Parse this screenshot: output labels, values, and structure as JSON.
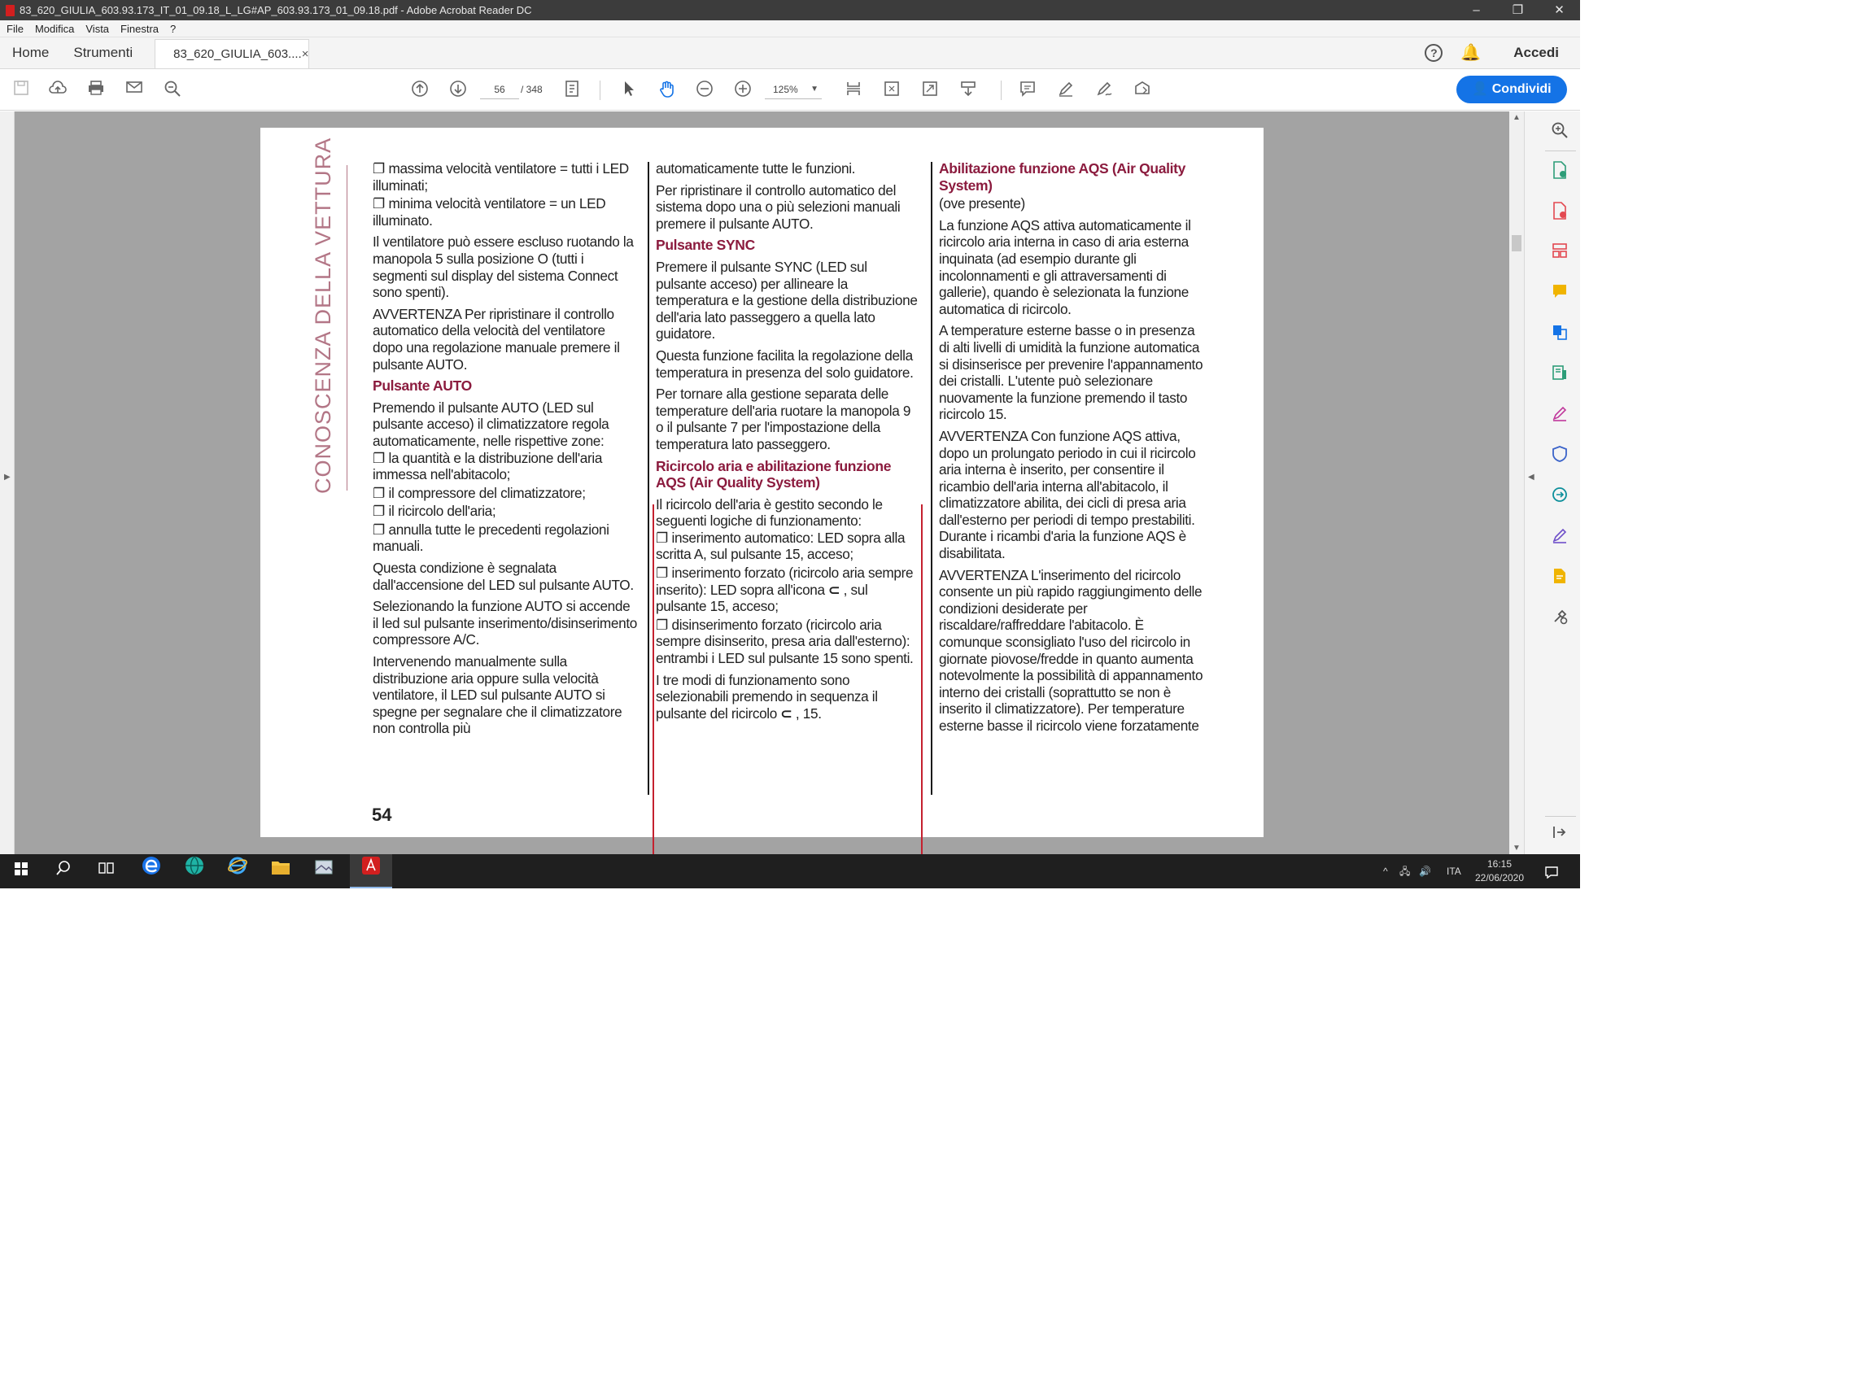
{
  "window": {
    "title": "83_620_GIULIA_603.93.173_IT_01_09.18_L_LG#AP_603.93.173_01_09.18.pdf - Adobe Acrobat Reader DC",
    "minimize": "–",
    "restore": "❐",
    "close": "✕"
  },
  "menu": [
    "File",
    "Modifica",
    "Vista",
    "Finestra",
    "?"
  ],
  "tabs": {
    "home": "Home",
    "tools": "Strumenti",
    "document": "83_620_GIULIA_603....",
    "close": "×",
    "help": "?",
    "signin": "Accedi"
  },
  "toolbar": {
    "page_current": "56",
    "page_total": "/ 348",
    "zoom": "125%",
    "share_label": "Condividi",
    "accent": "#1473e6"
  },
  "document": {
    "side_banner": "CONOSCENZA DELLA VETTURA",
    "page_number": "54",
    "heading_color": "#8b1b3e",
    "col1": {
      "l1": "❐ massima velocità ventilatore = tutti i LED illuminati;",
      "l2": "❐ minima velocità ventilatore = un LED illuminato.",
      "p1": "Il ventilatore può essere escluso ruotando la manopola 5 sulla posizione O (tutti i segmenti sul display del sistema Connect sono spenti).",
      "p2": "AVVERTENZA Per ripristinare il controllo automatico della velocità del ventilatore dopo una regolazione manuale premere il pulsante AUTO.",
      "h1": "Pulsante AUTO",
      "p3": "Premendo il pulsante AUTO (LED sul pulsante acceso) il climatizzatore regola automaticamente, nelle rispettive zone:",
      "l3": "❐ la quantità e la distribuzione dell'aria immessa nell'abitacolo;",
      "l4": "❐ il compressore del climatizzatore;",
      "l5": "❐ il ricircolo dell'aria;",
      "l6": "❐ annulla tutte le precedenti regolazioni manuali.",
      "p4": "Questa condizione è segnalata dall'accensione del LED sul pulsante AUTO.",
      "p5": "Selezionando la funzione AUTO si accende il led sul pulsante inserimento/disinserimento compressore A/C.",
      "p6": "Intervenendo manualmente sulla distribuzione aria oppure sulla velocità ventilatore, il LED sul pulsante AUTO si spegne per segnalare che il climatizzatore non controlla più"
    },
    "col2": {
      "p1": "automaticamente tutte le funzioni.",
      "p2": "Per ripristinare il controllo automatico del sistema dopo una o più selezioni manuali premere il pulsante AUTO.",
      "h1": "Pulsante SYNC",
      "p3": "Premere il pulsante SYNC (LED sul pulsante acceso) per allineare la temperatura e la gestione della distribuzione dell'aria lato passeggero a quella lato guidatore.",
      "p4": "Questa funzione facilita la regolazione della temperatura in presenza del solo guidatore.",
      "p5": "Per tornare alla gestione separata delle temperature dell'aria ruotare la manopola 9 o il pulsante 7 per l'impostazione della temperatura lato passeggero.",
      "h2": "Ricircolo aria e abilitazione funzione AQS (Air Quality System)",
      "p6": "Il ricircolo dell'aria è gestito secondo le seguenti logiche di funzionamento:",
      "l1": "❐ inserimento automatico: LED sopra alla scritta A, sul pulsante 15, acceso;",
      "l2a": "❐ inserimento forzato (ricircolo aria sempre inserito): LED sopra all'icona",
      "l2icon": "⊂",
      "l2b": ", sul pulsante 15, acceso;",
      "l3": "❐ disinserimento forzato (ricircolo aria sempre disinserito, presa aria dall'esterno): entrambi i LED sul pulsante 15 sono spenti.",
      "p7a": "I tre modi di funzionamento sono selezionabili premendo in sequenza il pulsante del ricircolo",
      "p7icon": "⊂",
      "p7b": ", 15."
    },
    "col3": {
      "h1": "Abilitazione funzione AQS (Air Quality System)",
      "p1": "(ove presente)",
      "p2": "La funzione AQS attiva automaticamente il ricircolo aria interna in caso di aria esterna inquinata (ad esempio durante gli incolonnamenti e gli attraversamenti di gallerie), quando è selezionata la funzione automatica di ricircolo.",
      "p3": "A temperature esterne basse o in presenza di alti livelli di umidità la funzione automatica si disinserisce per prevenire l'appannamento dei cristalli. L'utente può selezionare nuovamente la funzione premendo il tasto ricircolo 15.",
      "p4": "AVVERTENZA Con funzione AQS attiva, dopo un prolungato periodo in cui il ricircolo aria interna è inserito, per consentire il ricambio dell'aria interna all'abitacolo, il climatizzatore abilita, dei cicli di presa aria dall'esterno per periodi di tempo prestabiliti. Durante i ricambi d'aria la funzione AQS è disabilitata.",
      "p5": "AVVERTENZA L'inserimento del ricircolo consente un più rapido raggiungimento delle condizioni desiderate per riscaldare/raffreddare l'abitacolo. È comunque sconsigliato l'uso del ricircolo in giornate piovose/fredde in quanto aumenta notevolmente la possibilità di appannamento interno dei cristalli (soprattutto se non è inserito il climatizzatore). Per temperature esterne basse il ricircolo viene forzatamente"
    }
  },
  "taskbar": {
    "language": "ITA",
    "time": "16:15",
    "date": "22/06/2020"
  }
}
